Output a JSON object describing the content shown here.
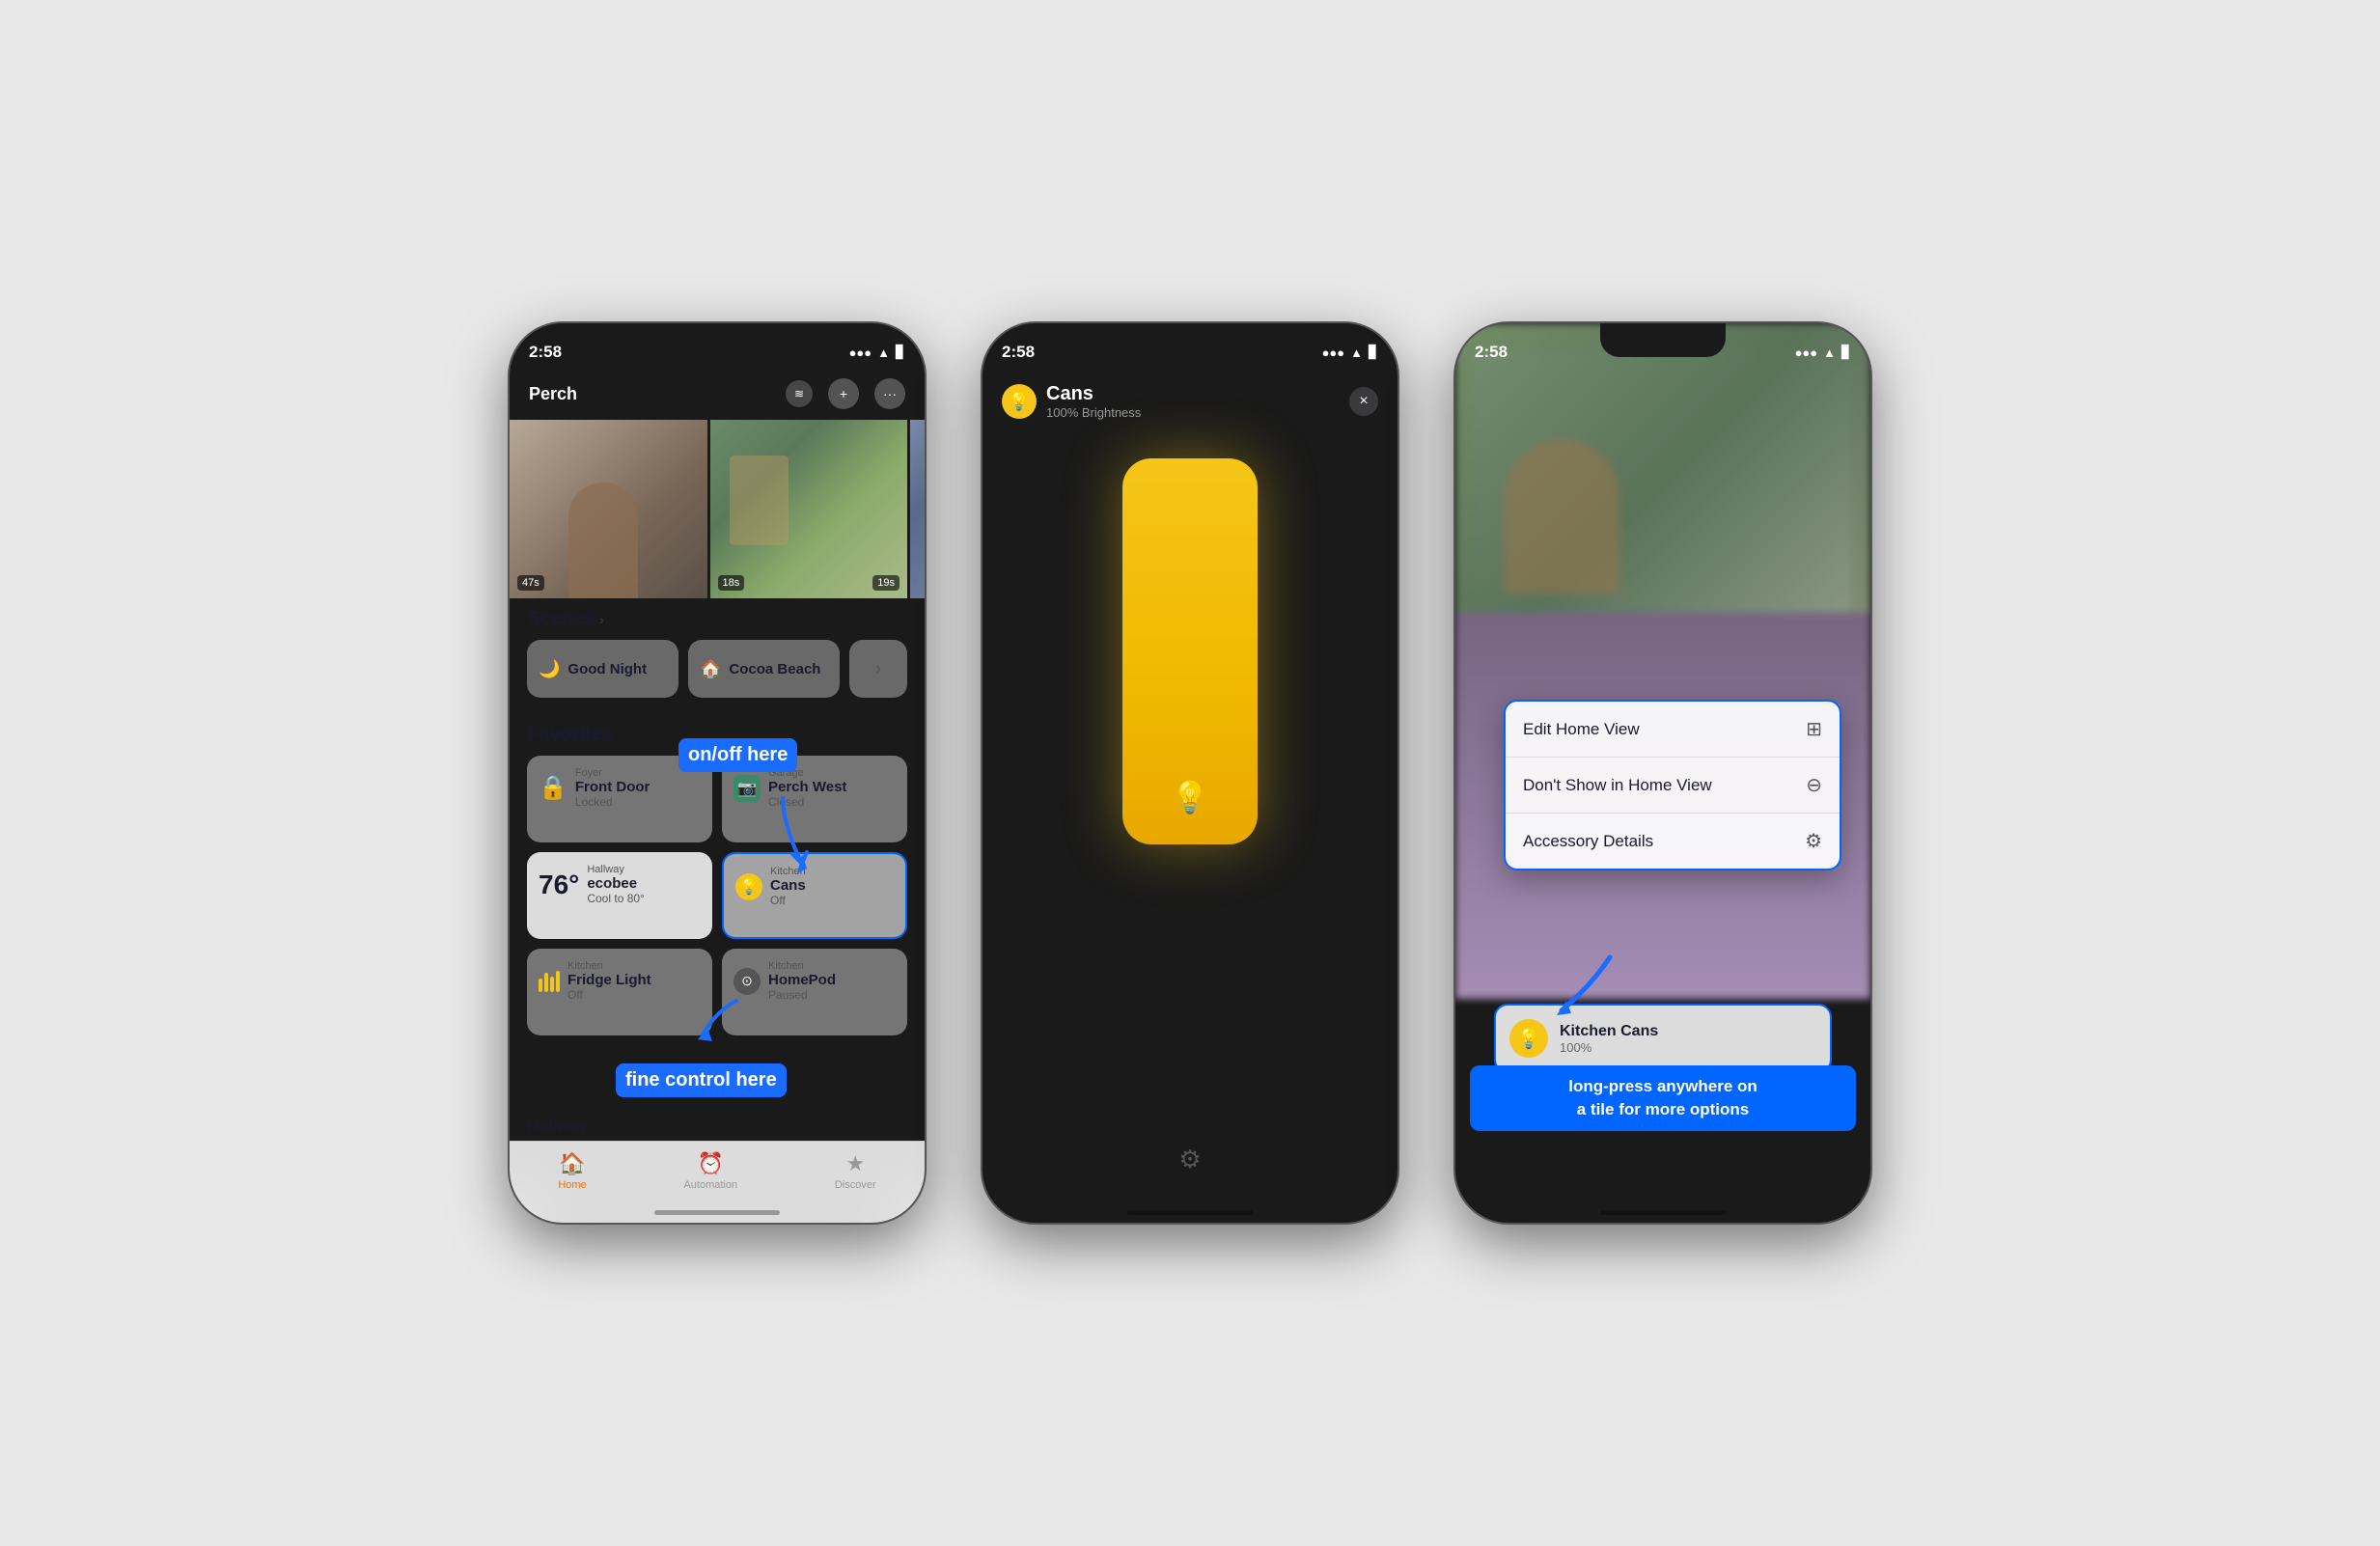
{
  "phones": [
    {
      "id": "phone1",
      "statusBar": {
        "time": "2:58",
        "signal": "●●●",
        "wifi": "WiFi",
        "battery": "🔋"
      },
      "nav": {
        "title": "Perch",
        "addButton": "+",
        "moreButton": "···"
      },
      "cameras": [
        {
          "timestamp": "47s"
        },
        {
          "timestamp": "18s"
        },
        {
          "timestamp": "19s"
        }
      ],
      "scenes": {
        "header": "Scenes",
        "items": [
          {
            "icon": "🌙",
            "label": "Good Night"
          },
          {
            "icon": "🏠",
            "label": "Cocoa Beach"
          }
        ]
      },
      "favorites": {
        "header": "Favorites",
        "items": [
          {
            "location": "Foyer",
            "name": "Front Door",
            "status": "Locked",
            "icon": "🔒",
            "type": "lock"
          },
          {
            "location": "Garage",
            "name": "Perch West",
            "status": "Closed",
            "icon": "📷",
            "type": "camera",
            "iconBg": "#3a7a6a"
          },
          {
            "temp": "76°",
            "location": "Hallway",
            "name": "ecobee",
            "status": "Cool to 80°",
            "icon": "⊕",
            "type": "thermostat"
          },
          {
            "location": "Kitchen",
            "name": "Cans",
            "status": "Off",
            "icon": "💡",
            "type": "light",
            "highlighted": true
          }
        ]
      },
      "favRow2": [
        {
          "location": "Kitchen",
          "name": "Fridge Light",
          "status": "Off",
          "icon": "🍟",
          "type": "fridge"
        },
        {
          "location": "Kitchen",
          "name": "HomePod",
          "status": "Paused",
          "icon": "⊙",
          "type": "homepod"
        }
      ],
      "annotations": {
        "onOff": "on/off here",
        "fineControl": "fine control here"
      },
      "tabs": [
        {
          "icon": "🏠",
          "label": "Home",
          "active": true
        },
        {
          "icon": "⚙",
          "label": "Automation",
          "active": false
        },
        {
          "icon": "★",
          "label": "Discover",
          "active": false
        }
      ],
      "hallwayPartial": "Hallway"
    },
    {
      "id": "phone2",
      "statusBar": {
        "time": "2:58"
      },
      "detail": {
        "title": "Cans",
        "subtitle": "100% Brightness",
        "icon": "💡",
        "closeButton": "×"
      }
    },
    {
      "id": "phone3",
      "statusBar": {
        "time": "2:58"
      },
      "contextMenu": {
        "items": [
          {
            "label": "Edit Home View",
            "icon": "⊞"
          },
          {
            "label": "Don't Show in Home View",
            "icon": "⊖"
          },
          {
            "label": "Accessory Details",
            "icon": "⚙"
          }
        ]
      },
      "tile": {
        "title": "Kitchen Cans",
        "subtitle": "100%",
        "icon": "💡"
      },
      "annotation": "long-press anywhere on\na tile for more options"
    }
  ]
}
